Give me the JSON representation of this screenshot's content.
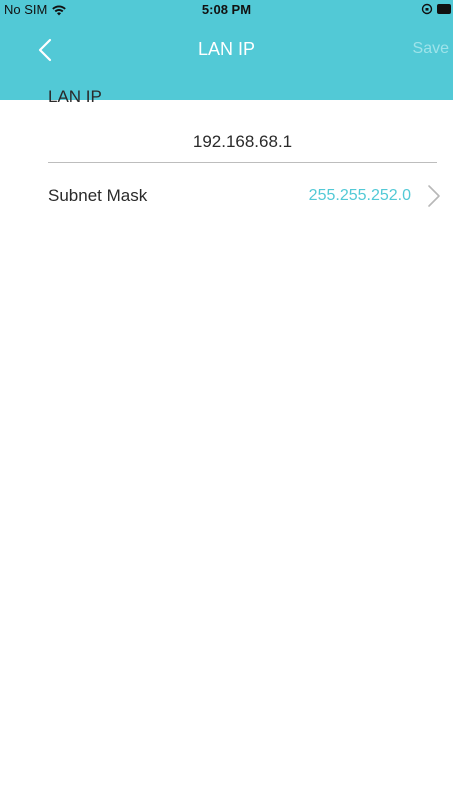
{
  "status_bar": {
    "carrier": "No SIM",
    "time": "5:08 PM"
  },
  "nav": {
    "title": "LAN IP",
    "save_label": "Save"
  },
  "form": {
    "lan_ip_label": "LAN IP",
    "lan_ip_value": "192.168.68.1",
    "subnet_label": "Subnet Mask",
    "subnet_value": "255.255.252.0"
  },
  "colors": {
    "accent": "#52c9d6",
    "save_disabled": "#9ee3ea"
  },
  "icons": {
    "back": "chevron-left-icon",
    "row_chevron": "chevron-right-icon",
    "wifi": "wifi-icon",
    "battery": "battery-icon",
    "rotation_lock": "rotation-lock-icon"
  }
}
